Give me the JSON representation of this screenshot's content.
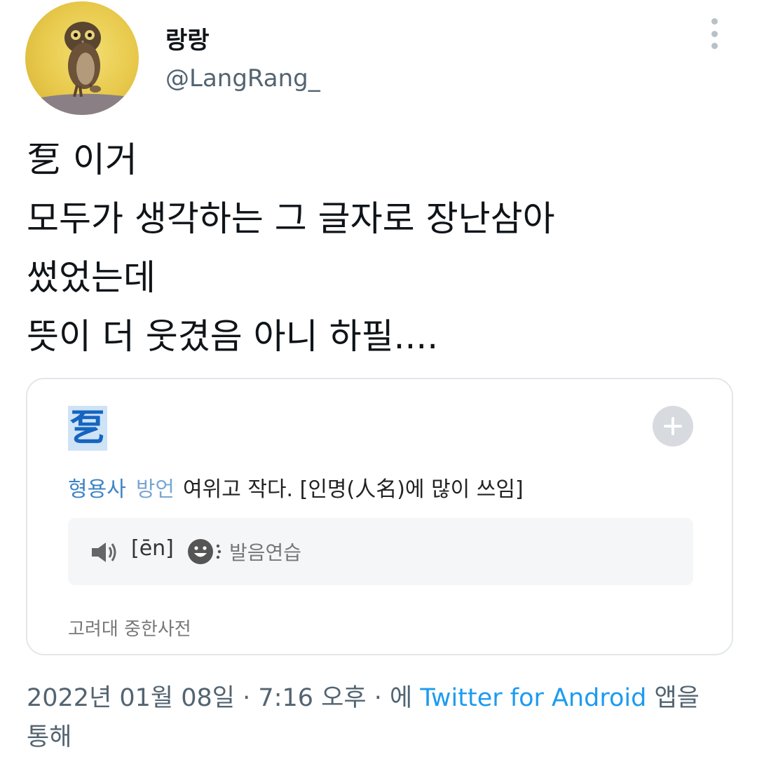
{
  "user": {
    "display_name": "랑랑",
    "handle": "@LangRang_"
  },
  "tweet": {
    "lines": [
      "乭 이거",
      "모두가 생각하는 그 글자로 장난삼아",
      "썼었는데",
      "뜻이 더 웃겼음 아니 하필...."
    ]
  },
  "card": {
    "headword": "乭",
    "part_of_speech": "형용사",
    "dialect_tag": "방언",
    "definition": "여위고 작다. [인명(人名)에 많이 쓰임]",
    "pronunciation": "[ēn]",
    "practice_label": "발음연습",
    "source": "고려대 중한사전"
  },
  "meta": {
    "date": "2022년 01월 08일",
    "time": "7:16 오후",
    "separator": "·",
    "via_prefix": "에",
    "app": "Twitter for Android",
    "suffix_line1": "앱을",
    "suffix_line2": "통해"
  },
  "colors": {
    "link_blue": "#1d9bf0",
    "meta_gray": "#536471",
    "headword_blue": "#1565c0"
  },
  "icons": [
    "owl-avatar",
    "more-vertical-icon",
    "plus-icon",
    "speaker-icon",
    "pronunciation-practice-icon"
  ]
}
